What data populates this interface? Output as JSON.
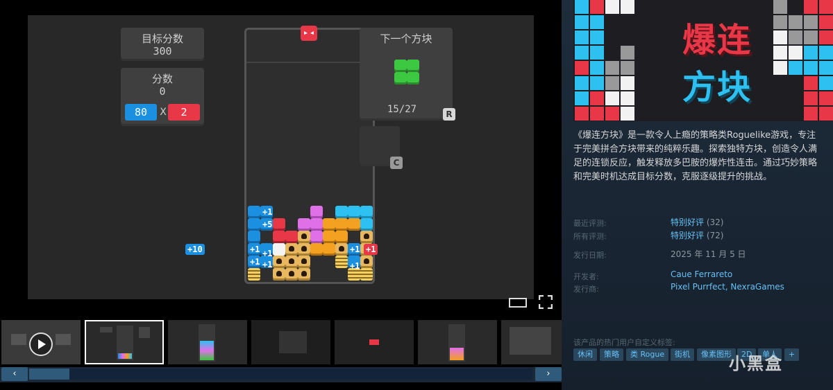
{
  "game_ui": {
    "target_label": "目标分数",
    "target_value": "300",
    "score_label": "分数",
    "score_value": "0",
    "chips": "80",
    "mult_sign": "X",
    "mult": "2",
    "next_label": "下一个方块",
    "piece_count": "15/27",
    "key_rotate": "R",
    "key_hold": "C",
    "float_left": "+10",
    "float_right": "+1",
    "board_tags": [
      "+1",
      "+5",
      "+1",
      "+1",
      "+1",
      "+1",
      "+1",
      "+1"
    ]
  },
  "capsule": {
    "title_line1": "爆连",
    "title_line2": "方块"
  },
  "description": "《爆连方块》是一款令人上瘾的策略类Roguelike游戏，专注于完美拼合方块带来的纯粹乐趣。探索独特方块，创造令人满足的连锁反应，触发释放多巴胺的爆炸性连击。通过巧妙策略和完美时机达成目标分数，克服逐级提升的挑战。",
  "reviews": {
    "recent_label": "最近评测:",
    "recent_value": "特别好评",
    "recent_count": "(32)",
    "all_label": "所有评测:",
    "all_value": "特别好评",
    "all_count": "(72)"
  },
  "release": {
    "label": "发行日期:",
    "value": "2025 年 11 月 5 日"
  },
  "developer": {
    "label": "开发者:",
    "value": "Caue Ferrareto"
  },
  "publisher": {
    "label": "发行商:",
    "value": "Pixel Purrfect, NexraGames"
  },
  "tags": {
    "label": "该产品的热门用户自定义标签:",
    "items": [
      "休闲",
      "策略",
      "类 Rogue",
      "街机",
      "像素图形",
      "2D",
      "单人",
      "+"
    ]
  },
  "watermark": "小黑盒",
  "nav": {
    "prev": "‹",
    "next": "›"
  },
  "colors": {
    "steam_bg": "#1b2838",
    "link": "#66c0f4",
    "tag_bg": "#2a475e"
  }
}
